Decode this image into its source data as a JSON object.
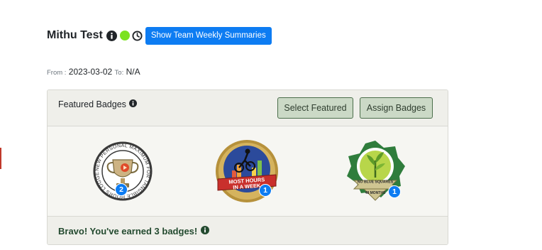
{
  "header": {
    "user_name": "Mithu Test",
    "status_color": "#7be21f",
    "team_button_label": "Show Team Weekly Summaries"
  },
  "dates": {
    "from_label": "From :",
    "from_value": "2023-03-02",
    "to_label": "To:",
    "to_value": "N/A"
  },
  "featured": {
    "title": "Featured Badges",
    "select_button": "Select Featured",
    "assign_button": "Assign Badges"
  },
  "badges": [
    {
      "name": "personal-maximum-badge",
      "ring_text": "NEW PERSONAL MAXIMUM FOR TANGIBLE HOURS LOGGED",
      "count": "2"
    },
    {
      "name": "most-hours-in-week-badge",
      "line1": "MOST HOURS",
      "line2": "IN A WEEK",
      "count": "1"
    },
    {
      "name": "no-blue-squares-badge",
      "line1": "NO BLUE SQUARES",
      "line2": "48 MONTHS",
      "count": "1"
    }
  ],
  "footer": {
    "text": "Bravo! You've earned 3 badges!"
  },
  "colors": {
    "primary": "#0d7cf2",
    "accent_green": "#234a2f",
    "button_green": "#cbd9c6"
  }
}
